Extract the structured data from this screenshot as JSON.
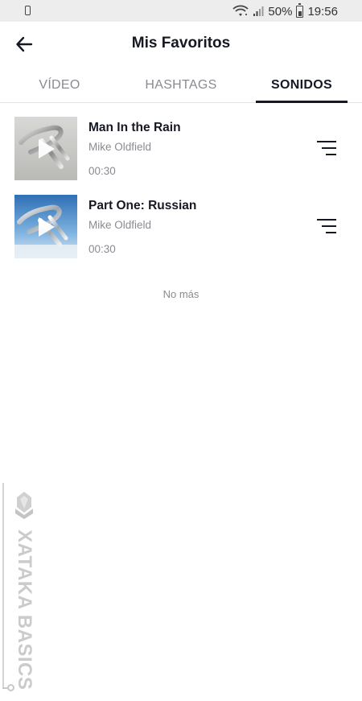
{
  "status_bar": {
    "battery_percent": "50%",
    "time": "19:56",
    "icons": [
      "phone-icon",
      "wifi-icon",
      "signal-icon",
      "battery-icon"
    ]
  },
  "header": {
    "title": "Mis Favoritos",
    "back_icon": "arrow-left-icon"
  },
  "tabs": [
    {
      "label": "VÍDEO",
      "active": false
    },
    {
      "label": "HASHTAGS",
      "active": false
    },
    {
      "label": "SONIDOS",
      "active": true
    }
  ],
  "sounds": [
    {
      "title": "Man In the Rain",
      "artist": "Mike Oldfield",
      "duration": "00:30",
      "cover": "grey-tubular-bells-cover",
      "menu_icon": "list-menu-icon"
    },
    {
      "title": "Part One: Russian",
      "artist": "Mike Oldfield",
      "duration": "00:30",
      "cover": "sky-tubular-bells-cover",
      "menu_icon": "list-menu-icon"
    }
  ],
  "footer_text": "No más",
  "watermark": {
    "text": "XATAKA BASICS"
  },
  "colors": {
    "text_primary": "#161823",
    "text_secondary": "#8a8b91",
    "status_bar_bg": "#ededed"
  }
}
